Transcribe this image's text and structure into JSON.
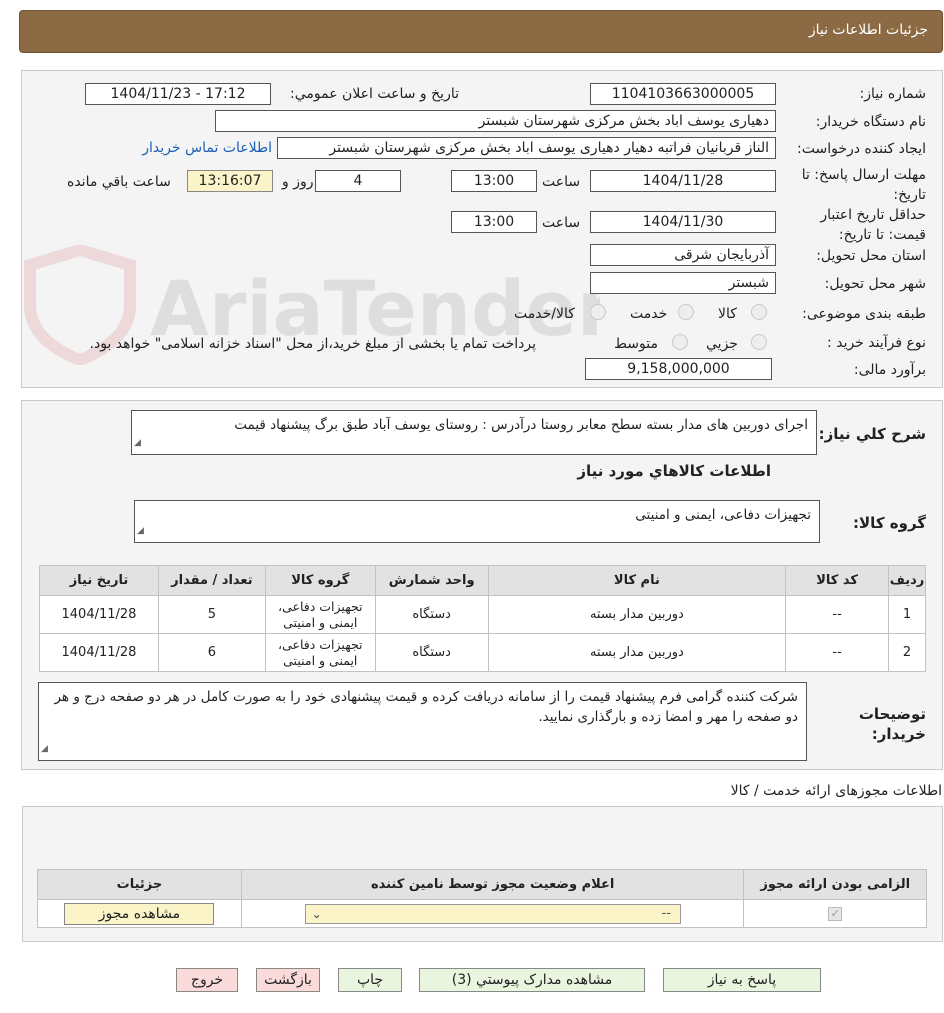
{
  "header": {
    "title": "جزئیات اطلاعات نیاز"
  },
  "watermark": {
    "text": "AriaTender.neT"
  },
  "info": {
    "need_number_label": "شماره نیاز:",
    "need_number": "1104103663000005",
    "announce_label": "تاریخ و ساعت اعلان عمومي:",
    "announce_value": "1404/11/23 - 17:12",
    "buyer_org_label": "نام دستگاه خریدار:",
    "buyer_org": "دهیاری یوسف اباد بخش مرکزی شهرستان شبستر",
    "requester_label": "ایجاد کننده درخواست:",
    "requester": "الناز قربانیان فراتبه دهیار دهیاری یوسف اباد بخش مرکزی شهرستان شبستر",
    "contact_link": "اطلاعات تماس خریدار",
    "reply_deadline_label": "مهلت ارسال پاسخ: تا تاریخ:",
    "reply_date": "1404/11/28",
    "time_label": "ساعت",
    "reply_time": "13:00",
    "days_value": "4",
    "days_label": "روز و",
    "remaining_time": "13:16:07",
    "remaining_label": "ساعت باقي مانده",
    "validity_label": "حداقل تاریخ اعتبار قیمت: تا تاریخ:",
    "validity_date": "1404/11/30",
    "validity_time_label": "ساعت",
    "validity_time": "13:00",
    "province_label": "استان محل تحویل:",
    "province": "آذربایجان شرقی",
    "city_label": "شهر محل تحویل:",
    "city": "شبستر",
    "category_label": "طبقه بندی موضوعی:",
    "category_options": [
      "کالا",
      "خدمت",
      "کالا/خدمت"
    ],
    "process_label": "نوع فرآیند خرید :",
    "process_options": [
      "جزيي",
      "متوسط"
    ],
    "payment_note": "پرداخت تمام یا بخشی از مبلغ خرید،از محل \"اسناد خزانه اسلامی\" خواهد بود.",
    "budget_label": "برآورد مالی:",
    "budget": "9,158,000,000"
  },
  "details": {
    "description_label": "شرح كلي نياز:",
    "description": "اجرای دوربین های مدار بسته سطح معابر روستا  درآدرس : روستای  یوسف آباد  طبق برگ پیشنهاد قیمت",
    "goods_info_title": "اطلاعات کالاهاي مورد نياز",
    "goods_group_label": "گروه کالا:",
    "goods_group": "تجهیزات دفاعی، ایمنی و امنیتی",
    "table_headers": [
      "ردیف",
      "کد کالا",
      "نام کالا",
      "واحد شمارش",
      "گروه کالا",
      "تعداد / مقدار",
      "تاریخ نیاز"
    ],
    "rows": [
      [
        "1",
        "--",
        "دوربین مدار بسته",
        "دستگاه",
        "تجهیزات دفاعی، ایمنی و امنیتی",
        "5",
        "1404/11/28"
      ],
      [
        "2",
        "--",
        "دوربین مدار بسته",
        "دستگاه",
        "تجهیزات دفاعی، ایمنی و امنیتی",
        "6",
        "1404/11/28"
      ]
    ],
    "buyer_notes_label": "توضیحات خریدار:",
    "buyer_notes": "شرکت کننده گرامی فرم پیشنهاد قیمت را از سامانه دریافت کرده و قیمت پیشنهادی خود را به صورت کامل  در هر دو صفحه درج و هر دو صفحه را مهر و امضا زده و بارگذاری نمایید."
  },
  "permits": {
    "title": "اطلاعات مجوزهای ارائه خدمت / کالا",
    "headers": [
      "الزامی بودن ارائه مجوز",
      "اعلام وضعیت مجوز توسط نامین کننده",
      "جزئیات"
    ],
    "select_value": "--",
    "view_button": "مشاهده مجوز"
  },
  "buttons": {
    "reply": "پاسخ به نیاز",
    "attachments": "مشاهده مدارک پیوستي (3)",
    "print": "چاپ",
    "back": "بازگشت",
    "exit": "خروج"
  }
}
